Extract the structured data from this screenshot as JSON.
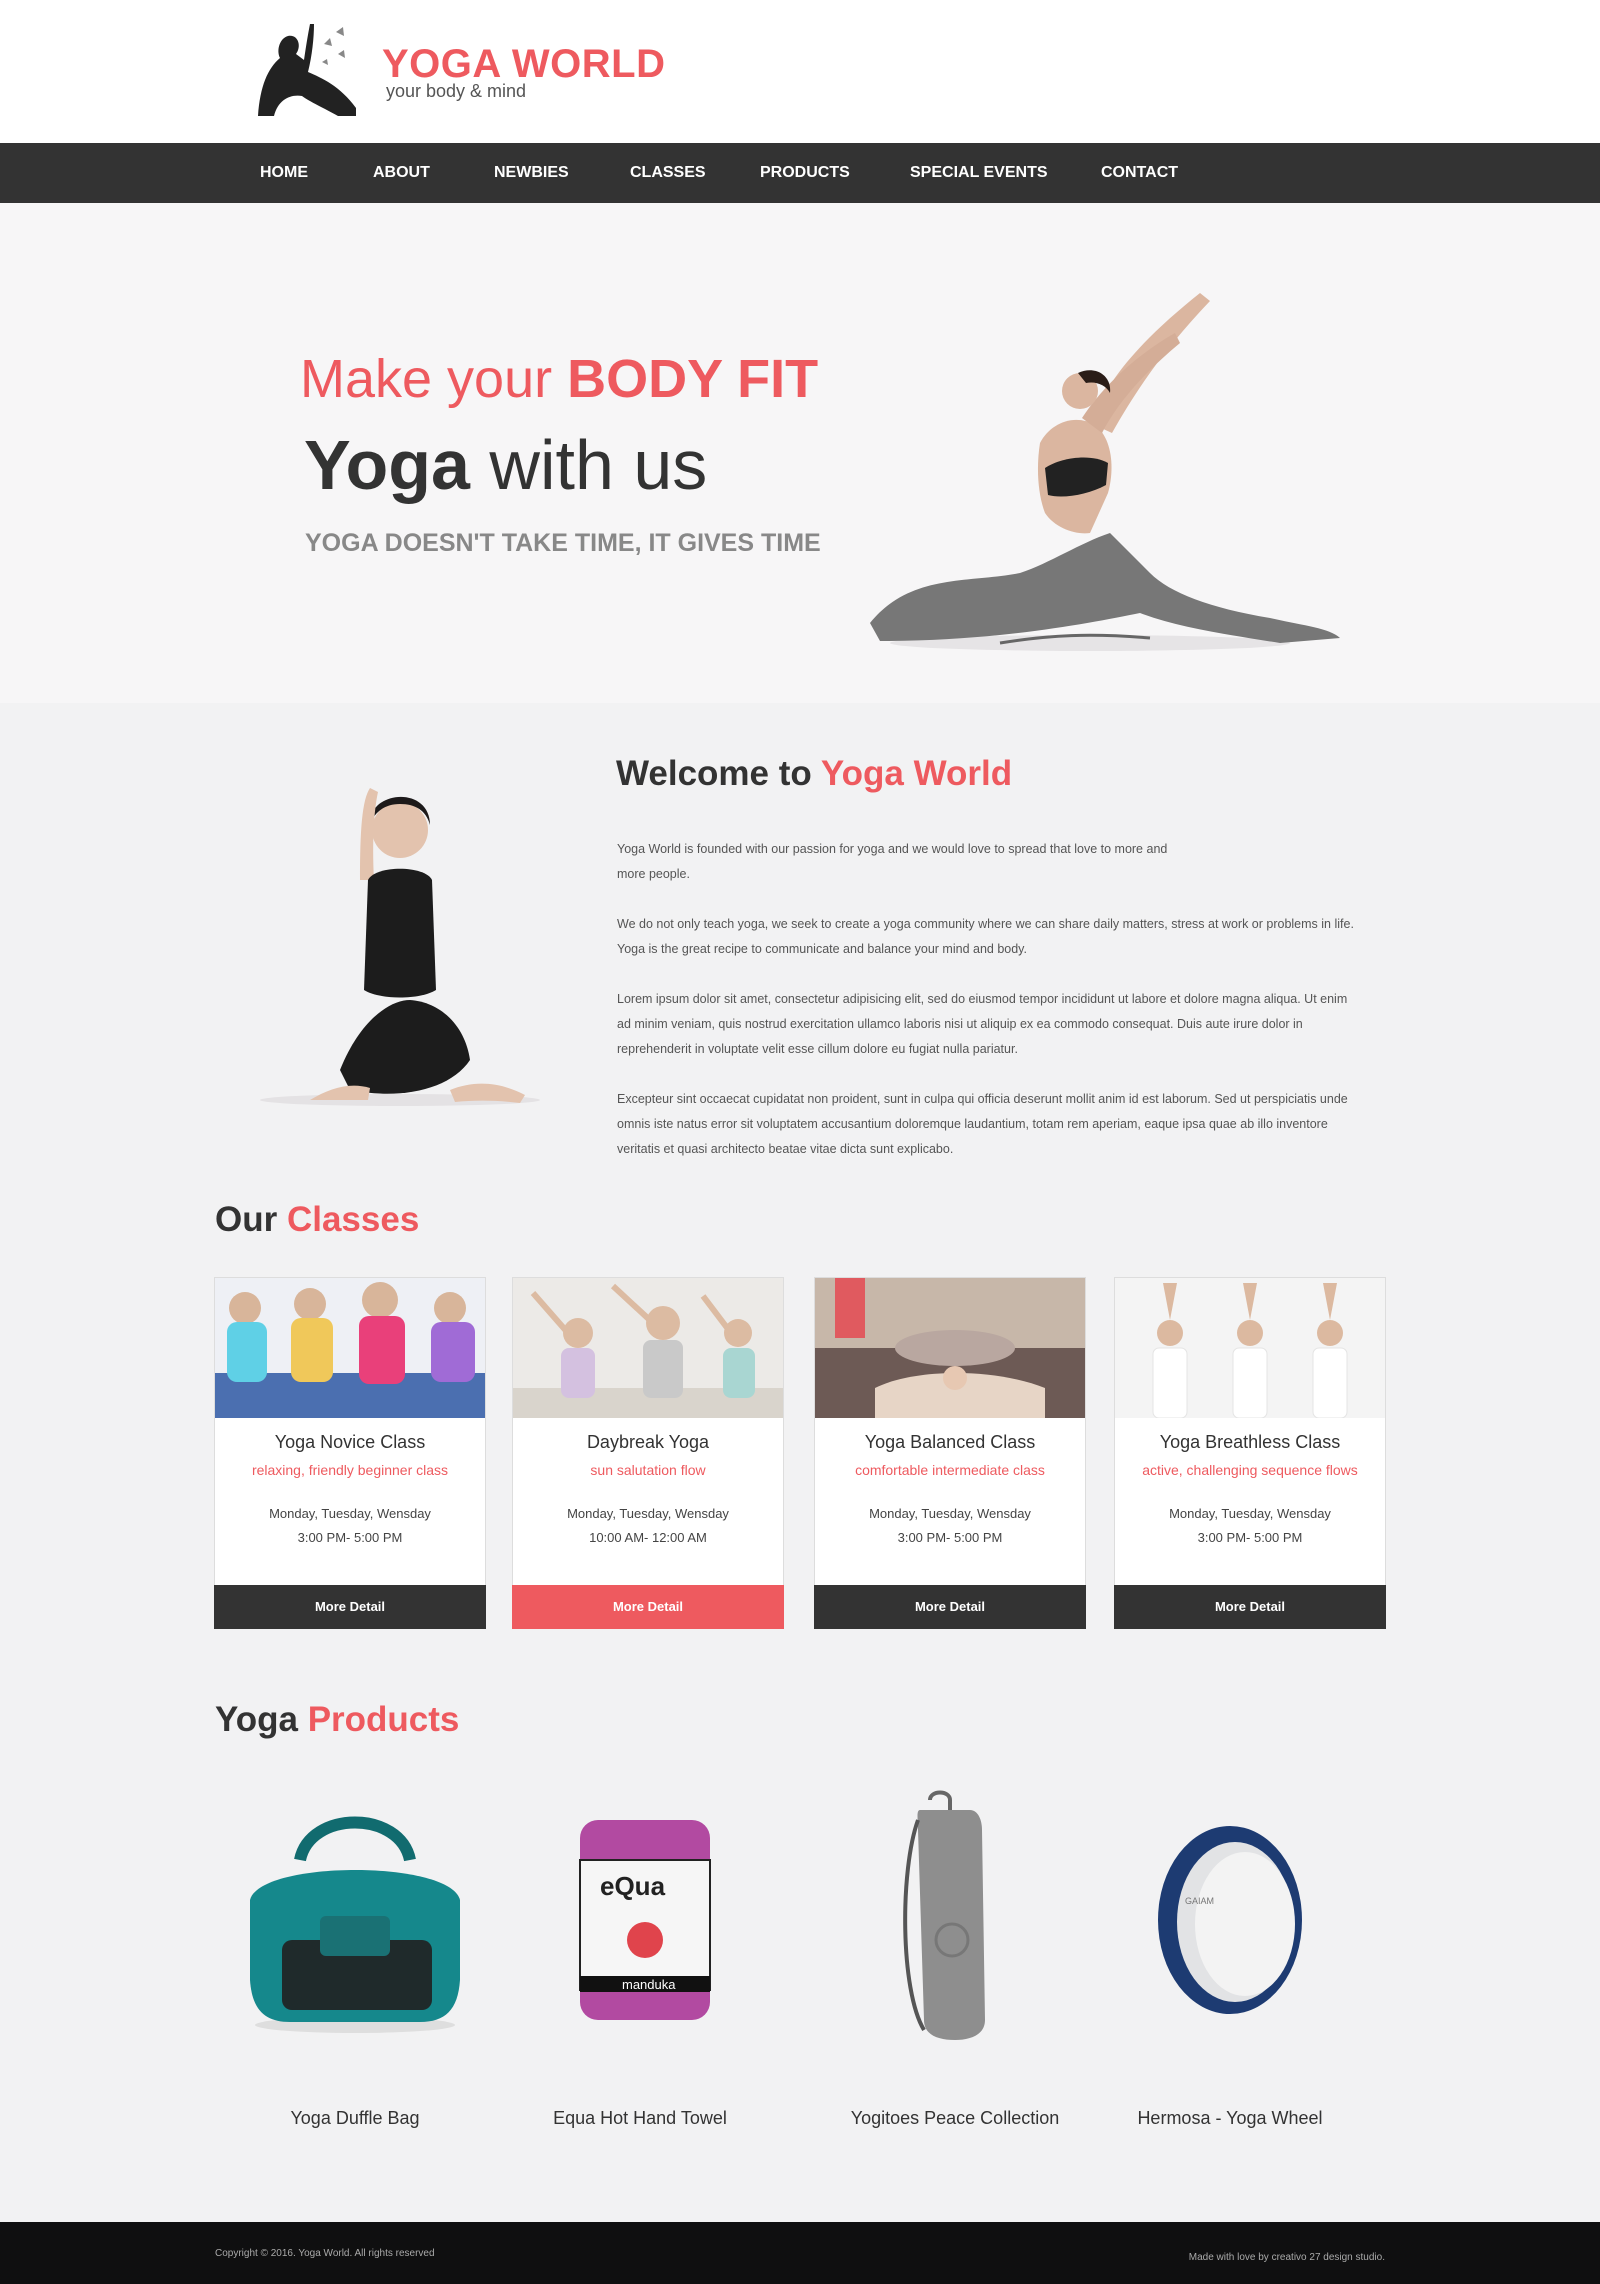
{
  "brand": {
    "title": "YOGA WORLD",
    "tagline": "your body & mind"
  },
  "nav": [
    "HOME",
    "ABOUT",
    "NEWBIES",
    "CLASSES",
    "PRODUCTS",
    "SPECIAL EVENTS",
    "CONTACT"
  ],
  "hero": {
    "line1_prefix": "Make your ",
    "line1_bold": "BODY FIT",
    "line2_bold": "Yoga",
    "line2_rest": " with us",
    "line3": "YOGA DOESN'T TAKE TIME, IT GIVES TIME"
  },
  "welcome": {
    "title_prefix": "Welcome to ",
    "title_accent": "Yoga World",
    "paragraphs": [
      "Yoga World is founded with our passion for yoga and we would love to spread that love to more and more people.",
      "We do not only teach yoga, we seek to create a yoga community where we can share daily matters, stress at work or problems in life. Yoga is the great recipe to communicate and balance your mind and body.",
      "Lorem ipsum dolor sit amet, consectetur adipisicing elit, sed do eiusmod tempor incididunt ut labore et dolore magna aliqua. Ut enim ad minim veniam, quis nostrud exercitation ullamco laboris nisi ut aliquip ex ea commodo consequat. Duis aute irure dolor in reprehenderit in voluptate velit esse cillum dolore eu fugiat nulla pariatur.",
      "Excepteur sint occaecat cupidatat non proident, sunt in culpa qui officia deserunt mollit anim id est laborum. Sed ut perspiciatis unde omnis iste natus error sit voluptatem accusantium doloremque laudantium, totam rem aperiam, eaque ipsa quae ab illo inventore veritatis et quasi architecto beatae vitae dicta sunt explicabo."
    ]
  },
  "classes_section": {
    "title_prefix": "Our ",
    "title_accent": "Classes",
    "cards": [
      {
        "title": "Yoga Novice Class",
        "subtitle": "relaxing, friendly beginner class",
        "days": "Monday, Tuesday, Wensday",
        "time": "3:00 PM- 5:00 PM",
        "button": "More Detail"
      },
      {
        "title": "Daybreak Yoga",
        "subtitle": "sun salutation flow",
        "days": "Monday, Tuesday, Wensday",
        "time": "10:00 AM- 12:00 AM",
        "button": "More Detail"
      },
      {
        "title": "Yoga Balanced Class",
        "subtitle": "comfortable intermediate class",
        "days": "Monday, Tuesday, Wensday",
        "time": "3:00 PM- 5:00 PM",
        "button": "More Detail"
      },
      {
        "title": "Yoga Breathless Class",
        "subtitle": "active, challenging sequence flows",
        "days": "Monday, Tuesday, Wensday",
        "time": "3:00 PM- 5:00 PM",
        "button": "More Detail"
      }
    ]
  },
  "products_section": {
    "title_prefix": "Yoga ",
    "title_accent": "Products",
    "items": [
      {
        "name": "Yoga Duffle Bag"
      },
      {
        "name": "Equa Hot Hand Towel",
        "label_brand": "eQua",
        "label_sub": "manduka"
      },
      {
        "name": "Yogitoes Peace Collection"
      },
      {
        "name": "Hermosa - Yoga Wheel",
        "label_brand": "GAIAM"
      }
    ]
  },
  "footer": {
    "copyright": "Copyright © 2016. Yoga World. All rights reserved",
    "credit": "Made with love by creativo 27 design studio."
  },
  "colors": {
    "accent": "#ee5a5f",
    "dark": "#333333",
    "footer": "#0f0f10"
  }
}
